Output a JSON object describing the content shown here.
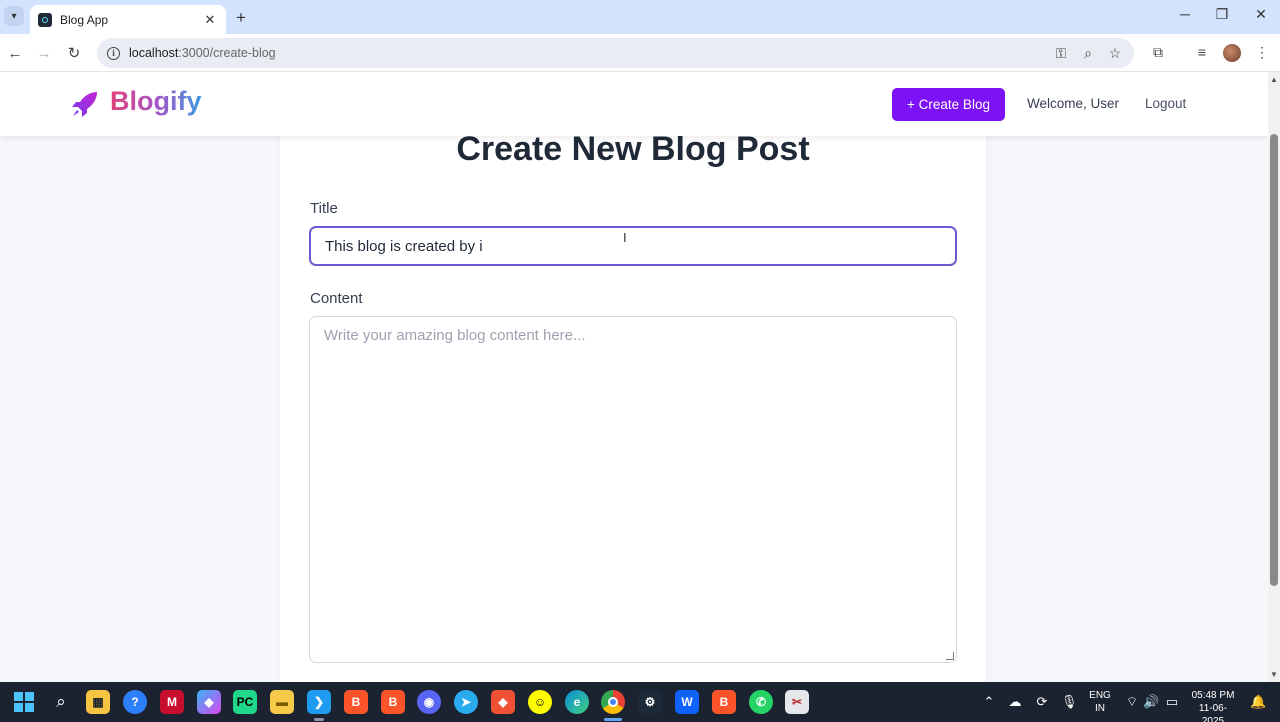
{
  "browser": {
    "tab_title": "Blog App",
    "tab_close": "✕",
    "new_tab": "+",
    "url_host": "localhost",
    "url_path": ":3000/create-blog",
    "window_controls": {
      "minimize": "─",
      "maximize": "❐",
      "close": "✕"
    }
  },
  "navbar": {
    "brand": "Blogify",
    "create_button": "+ Create Blog",
    "welcome": "Welcome, User",
    "logout": "Logout",
    "brand_colors": [
      "#e0417a",
      "#a855c7",
      "#3b9be0"
    ],
    "accent_color": "#7c12f5"
  },
  "form": {
    "heading": "Create New Blog Post",
    "title_label": "Title",
    "title_value": "This blog is created by i",
    "content_label": "Content",
    "content_placeholder": "Write your amazing blog content here..."
  },
  "taskbar": {
    "apps": [
      "windows-start",
      "search",
      "store",
      "help",
      "mcafee",
      "copilot",
      "pycharm",
      "file-explorer",
      "vscode",
      "brave-beta",
      "brave",
      "discord",
      "telegram",
      "git",
      "snapchat",
      "edge",
      "chrome",
      "steam",
      "webstorm",
      "brave-nightly",
      "whatsapp",
      "snipping-tool"
    ],
    "language": "ENG",
    "region": "IN",
    "time": "05:48 PM",
    "date": "11-06-2025"
  }
}
